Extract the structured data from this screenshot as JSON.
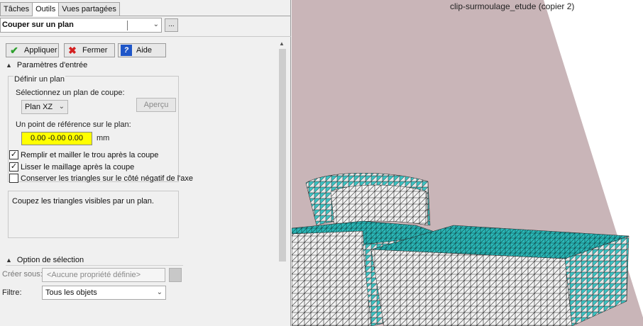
{
  "tabs": [
    "Tâches",
    "Outils",
    "Vues partagées"
  ],
  "tool_select": {
    "value": "Couper sur un plan",
    "more_label": "..."
  },
  "buttons": {
    "apply": "Appliquer",
    "close": "Fermer",
    "help": "Aide"
  },
  "input_params": {
    "header": "Paramètres d'entrée",
    "define_plane": "Définir un plan",
    "select_plane_label": "Sélectionnez un plan de coupe:",
    "plane_value": "Plan XZ",
    "preview_label": "Aperçu",
    "ref_point_label": "Un point de référence sur le plan:",
    "ref_point_value": "0.00 -0.00 0.00",
    "unit": "mm",
    "checkboxes": [
      {
        "label": "Remplir et mailler le trou après la coupe",
        "checked": true
      },
      {
        "label": "Lisser le maillage après la coupe",
        "checked": true
      },
      {
        "label": "Conserver les triangles sur le côté négatif de l'axe",
        "checked": false
      }
    ],
    "description": "Coupez les triangles visibles par un plan."
  },
  "selection_option": {
    "header": "Option de sélection",
    "create_under_label": "Créer sous:",
    "create_under_value": "<Aucune propriété définie>",
    "filter_label": "Filtre:",
    "filter_value": "Tous les objets"
  },
  "viewport": {
    "title": "clip-surmoulage_etude (copier 2)",
    "colors": {
      "plane": "#c9b5b8",
      "mesh_cyan": "#2ab8b8",
      "mesh_white": "#f2f2f2",
      "edge": "#1a1a1a"
    }
  }
}
